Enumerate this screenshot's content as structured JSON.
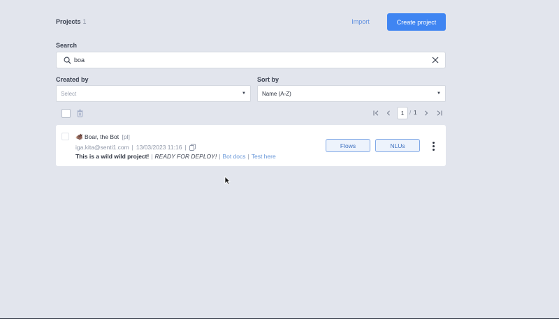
{
  "header": {
    "title": "Projects",
    "count": "1",
    "import_label": "Import",
    "create_label": "Create project"
  },
  "search": {
    "label": "Search",
    "value": "boa"
  },
  "filters": {
    "created_by_label": "Created by",
    "created_by_value": "Select",
    "sort_by_label": "Sort by",
    "sort_by_value": "Name (A-Z)"
  },
  "pagination": {
    "current": "1",
    "separator": "/",
    "total": "1"
  },
  "projects": [
    {
      "emoji": "🐗",
      "name": "Boar, the Bot",
      "lang": "[pl]",
      "email": "iga.kita@senti1.com",
      "date": "13/03/2023 11:16",
      "description": "This is a wild wild project!",
      "status": "READY FOR DEPLOY!",
      "links": [
        "Bot docs",
        "Test here"
      ],
      "buttons": [
        "Flows",
        "NLUs"
      ]
    }
  ],
  "colors": {
    "accent": "#3f85f2",
    "background": "#e2e5ed"
  },
  "icons": [
    "search-icon",
    "close-icon",
    "trash-icon",
    "first-page-icon",
    "prev-page-icon",
    "next-page-icon",
    "last-page-icon",
    "copy-icon",
    "more-vertical-icon",
    "mouse-cursor-icon"
  ]
}
